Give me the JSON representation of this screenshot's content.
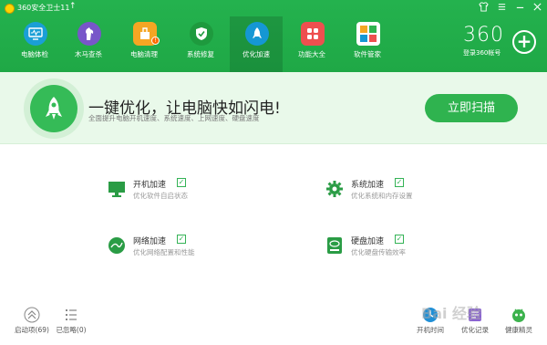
{
  "titlebar": {
    "app_title": "360安全卫士11",
    "up_icon": "arrow-up-icon",
    "controls": [
      "shirt-icon",
      "menu-icon",
      "minimize-icon",
      "close-icon"
    ]
  },
  "nav": {
    "items": [
      {
        "label": "电脑体检",
        "icon": "monitor-icon"
      },
      {
        "label": "木马查杀",
        "icon": "horse-icon"
      },
      {
        "label": "电脑清理",
        "icon": "broom-icon"
      },
      {
        "label": "系统修复",
        "icon": "shield-icon"
      },
      {
        "label": "优化加速",
        "icon": "rocket-icon"
      },
      {
        "label": "功能大全",
        "icon": "grid-icon"
      },
      {
        "label": "软件管家",
        "icon": "software-icon"
      }
    ],
    "active_index": 4,
    "brand": "360",
    "login": "登录360帐号"
  },
  "banner": {
    "title": "一键优化，让电脑快如闪电!",
    "subtitle": "全面提升电脑开机速度、系统速度、上网速度、硬盘速度",
    "scan_button": "立即扫描"
  },
  "options": [
    {
      "name": "开机加速",
      "desc": "优化软件自启状态",
      "icon": "screen-icon",
      "checked": true
    },
    {
      "name": "系统加速",
      "desc": "优化系统和内存设置",
      "icon": "gear-icon",
      "checked": true
    },
    {
      "name": "网络加速",
      "desc": "优化网络配置和性能",
      "icon": "globe-icon",
      "checked": true
    },
    {
      "name": "硬盘加速",
      "desc": "优化硬盘传输效率",
      "icon": "disk-icon",
      "checked": true
    }
  ],
  "footer": {
    "left": [
      {
        "label": "启动项(69)",
        "icon": "chevron-up-double-icon"
      },
      {
        "label": "已忽略(0)",
        "icon": "list-icon"
      }
    ],
    "right": [
      {
        "label": "开机时间",
        "icon": "clock-icon"
      },
      {
        "label": "优化记录",
        "icon": "record-icon"
      },
      {
        "label": "健康精灵",
        "icon": "sprite-icon"
      }
    ]
  },
  "watermark": "Bai 经验",
  "colors": {
    "brand_green": "#22b14c",
    "banner_bg": "#e9f9ea",
    "button_green": "#2fb34f"
  }
}
